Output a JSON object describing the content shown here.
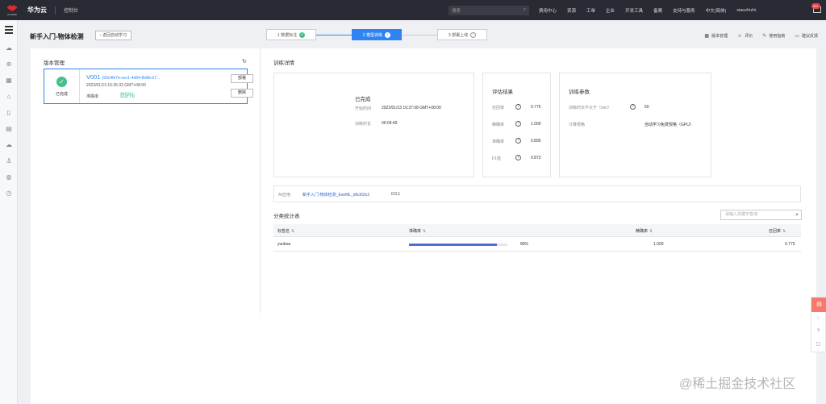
{
  "topbar": {
    "brand": "华为云",
    "logo_text": "HUAWEI",
    "console": "控制台",
    "search_placeholder": "搜索",
    "nav": [
      "费用中心",
      "资源",
      "工单",
      "企业",
      "开发工具",
      "备案",
      "支持与服务",
      "中文(简体)",
      "xiaozhizhi"
    ],
    "badge": "99+"
  },
  "header": {
    "title": "新手入门-物体检测",
    "back_label": "返回自动学习",
    "steps": [
      {
        "label": "1 数据标注",
        "state": "done"
      },
      {
        "label": "2 模型训练",
        "state": "active"
      },
      {
        "label": "3 部署上线",
        "state": "pending"
      }
    ],
    "actions": {
      "version_mgmt": "版本管理",
      "rate": "评价",
      "guide": "使用指南",
      "feedback": "建议反馈"
    }
  },
  "version_panel": {
    "title": "版本管理",
    "card": {
      "name": "V001",
      "id": "(93c4fe7e-cec1-4d64-8e8b-b7...",
      "time": "2022/01/13 16:36:33 GMT+08:00",
      "status": "已完成",
      "acc_label": "准确率:",
      "acc_value": "89%",
      "deploy": "部署",
      "delete": "删除"
    }
  },
  "details": {
    "title": "训练详情",
    "status": "已完成",
    "start_label": "开始时间",
    "start_value": "2022/01/13 16:37:08 GMT+08:00",
    "duration_label": "训练时长",
    "duration_value": "00:04:49"
  },
  "eval": {
    "title": "评估结果",
    "items": [
      {
        "label": "召回率",
        "value": "0.775"
      },
      {
        "label": "精确率",
        "value": "1.000"
      },
      {
        "label": "准确率",
        "value": "0.895"
      },
      {
        "label": "F1值",
        "value": "0.873"
      }
    ]
  },
  "params": {
    "title": "训练参数",
    "max_label": "训练时长不大于（min）",
    "max_value": "60",
    "spec_label": "计算规格",
    "spec_value": "自动学习免费规格（GPU）"
  },
  "ai_app": {
    "label": "AI应用:",
    "link": "新手入门-物体检测_ExeML_d6c81fc3",
    "version": "0.0.1"
  },
  "table": {
    "title": "分类统计表",
    "search_placeholder": "请输入关键字查询",
    "headers": [
      "标签名",
      "准确率",
      "精确率",
      "召回率"
    ],
    "rows": [
      {
        "name": "yunbao",
        "accuracy": "89%",
        "accuracy_fraction": 0.89,
        "precision": "1.000",
        "recall": "0.775"
      }
    ]
  },
  "watermark": "@稀土掘金技术社区",
  "colors": {
    "primary": "#2f84f2",
    "success": "#44c08b",
    "topbar": "#282b33"
  }
}
